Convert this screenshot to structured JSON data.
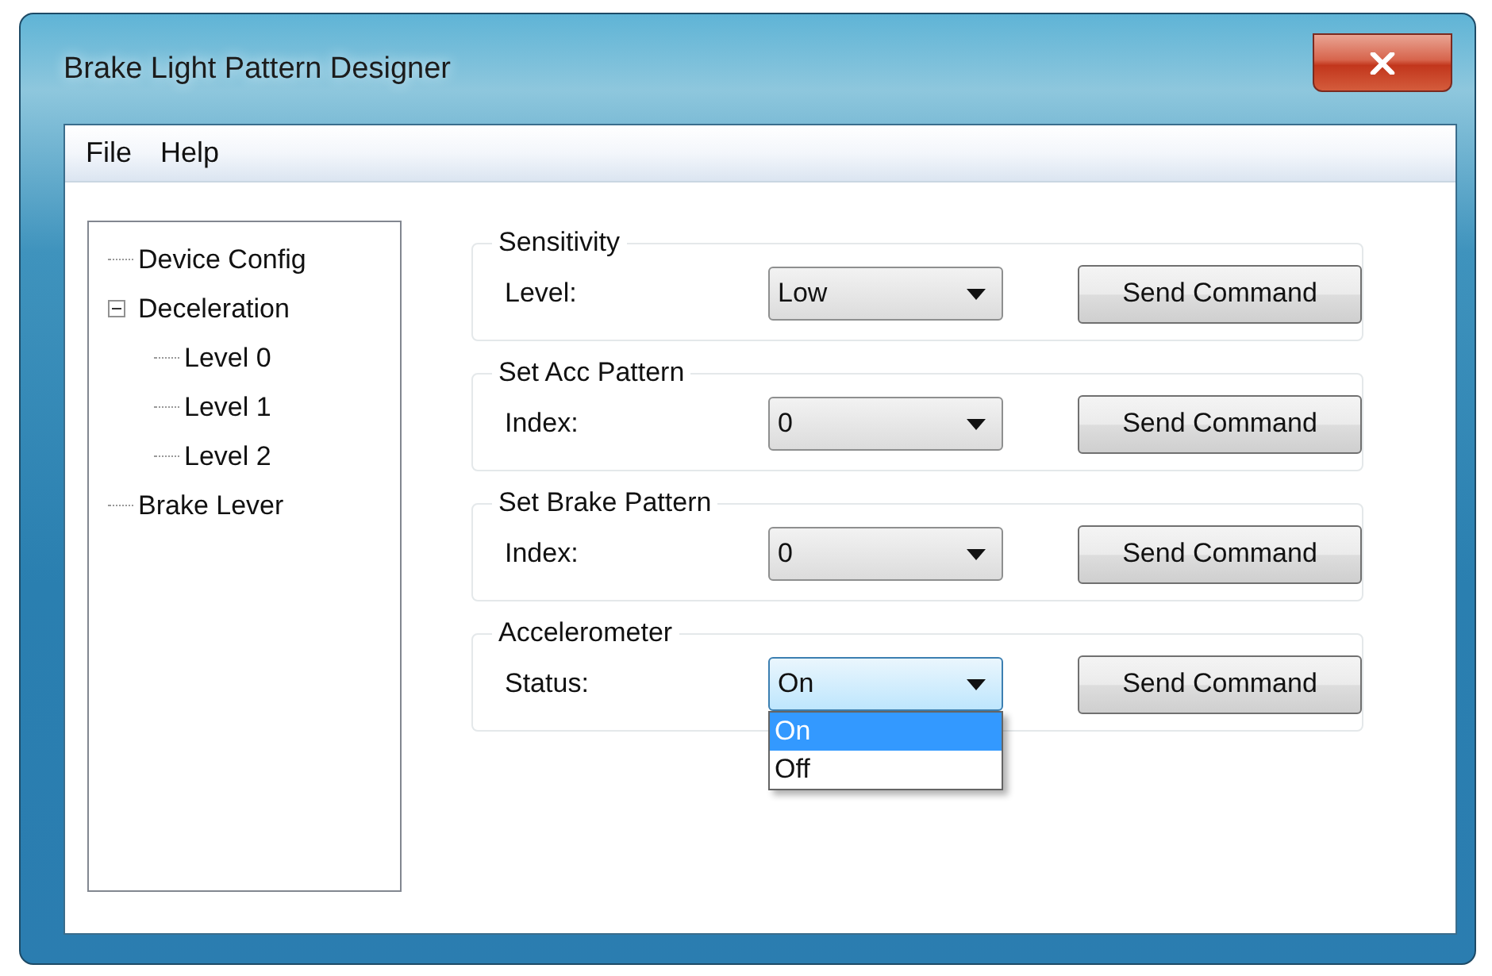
{
  "window": {
    "title": "Brake Light Pattern Designer"
  },
  "menu": [
    "File",
    "Help"
  ],
  "tree": [
    {
      "label": "Device Config"
    },
    {
      "label": "Deceleration",
      "expanded": true,
      "children": [
        {
          "label": "Level 0"
        },
        {
          "label": "Level 1"
        },
        {
          "label": "Level 2"
        }
      ]
    },
    {
      "label": "Brake Lever"
    }
  ],
  "groups": [
    {
      "title": "Sensitivity",
      "label": "Level:",
      "value": "Low",
      "open": false,
      "button": "Send Command"
    },
    {
      "title": "Set Acc Pattern",
      "label": "Index:",
      "value": "0",
      "open": false,
      "button": "Send Command"
    },
    {
      "title": "Set Brake Pattern",
      "label": "Index:",
      "value": "0",
      "open": false,
      "button": "Send Command"
    },
    {
      "title": "Accelerometer",
      "label": "Status:",
      "value": "On",
      "open": true,
      "options": [
        {
          "label": "On",
          "selected": true
        },
        {
          "label": "Off",
          "selected": false
        }
      ],
      "button": "Send Command"
    }
  ]
}
